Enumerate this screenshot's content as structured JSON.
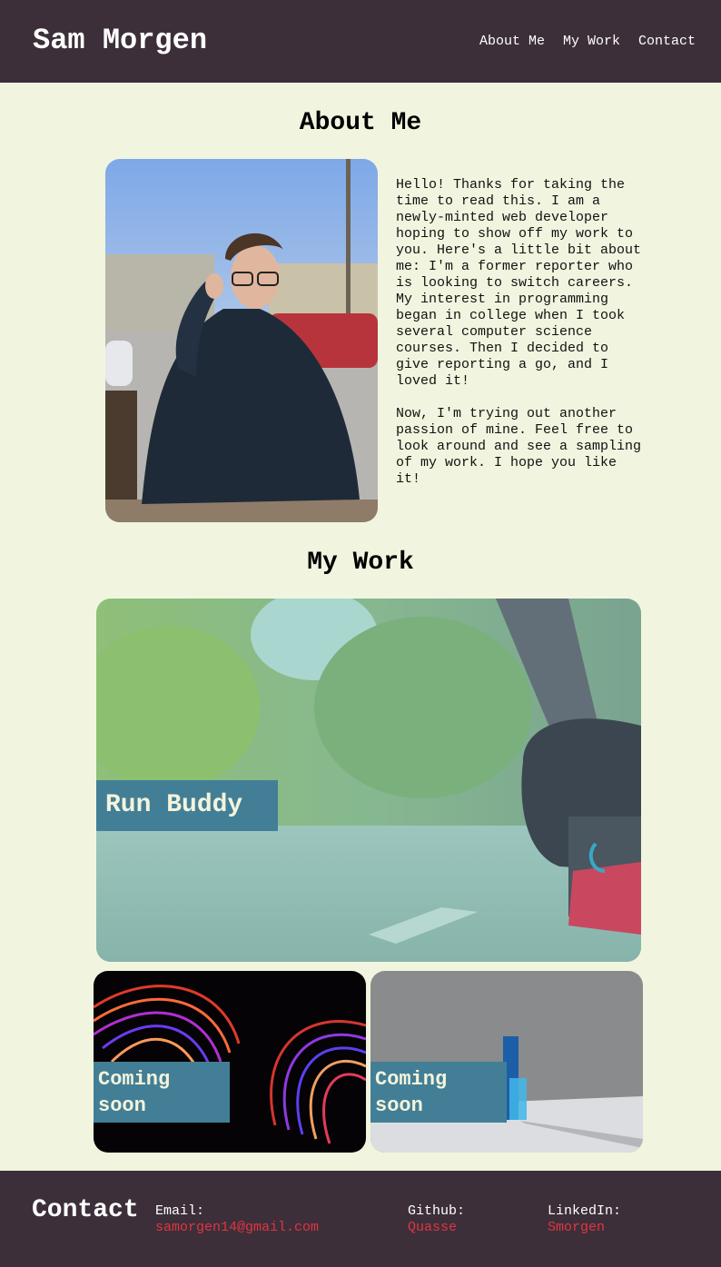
{
  "header": {
    "brand": "Sam Morgen",
    "nav": [
      "About Me",
      "My Work",
      "Contact"
    ]
  },
  "about": {
    "title": "About Me",
    "paragraph1": "Hello! Thanks for taking the time to read this. I am a newly-minted web developer hoping to show off my work to you. Here's a little bit about me: I'm a former reporter who is looking to switch careers. My interest in programming began in college when I took several computer science courses. Then I decided to give reporting a go, and I loved it!",
    "paragraph2": "Now, I'm trying out another passion of mine. Feel free to look around and see a sampling of my work. I hope you like it!"
  },
  "work": {
    "title": "My Work",
    "projects": [
      {
        "label": "Run Buddy"
      },
      {
        "label": "Coming soon"
      },
      {
        "label": "Coming soon"
      }
    ]
  },
  "footer": {
    "title": "Contact",
    "email_label": "Email:",
    "email": "samorgen14@gmail.com",
    "github_label": "Github:",
    "github": "Quasse",
    "linkedin_label": "LinkedIn:",
    "linkedin": "Smorgen"
  },
  "colors": {
    "header_bg": "#3c2f3a",
    "page_bg": "#f1f5df",
    "label_bg": "#427f96",
    "link": "#e2343f"
  }
}
